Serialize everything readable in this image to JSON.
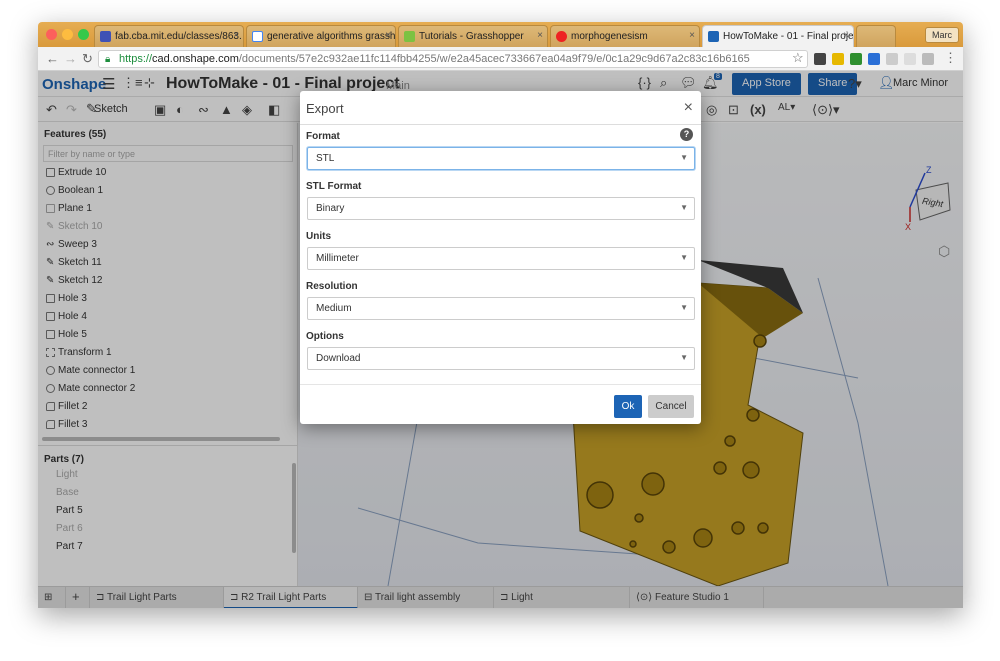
{
  "browser": {
    "tabs": [
      {
        "title": "fab.cba.mit.edu/classes/863.",
        "active": false
      },
      {
        "title": "generative algorithms grassho",
        "active": false
      },
      {
        "title": "Tutorials - Grasshopper",
        "active": false
      },
      {
        "title": "morphogenesism",
        "active": false
      },
      {
        "title": "HowToMake - 01 - Final proje",
        "active": true
      }
    ],
    "profile": "Marc",
    "url": {
      "scheme": "https://",
      "host": "cad.onshape.com",
      "path": "/documents/57e2c932ae11fc114fbb4255/w/e2a45acec733667ea04a9f79/e/0c1a29c9d67a2c83c16b6165"
    }
  },
  "app": {
    "logo": "Onshape",
    "document_title": "HowToMake - 01 - Final project",
    "branch": "Main",
    "app_store_label": "App Store",
    "share_label": "Share",
    "user_name": "Marc Minor",
    "notification_count": "8"
  },
  "toolbar": {
    "sketch_label": "Sketch"
  },
  "features": {
    "header": "Features (55)",
    "filter_placeholder": "Filter by name or type",
    "items": [
      {
        "label": "Extrude 10",
        "icon": "extrude-icon",
        "dim": false
      },
      {
        "label": "Boolean 1",
        "icon": "boolean-icon",
        "dim": false
      },
      {
        "label": "Plane 1",
        "icon": "plane-icon",
        "dim": false
      },
      {
        "label": "Sketch 10",
        "icon": "sketch-icon",
        "dim": true
      },
      {
        "label": "Sweep 3",
        "icon": "sweep-icon",
        "dim": false
      },
      {
        "label": "Sketch 11",
        "icon": "sketch-icon",
        "dim": false
      },
      {
        "label": "Sketch 12",
        "icon": "sketch-icon",
        "dim": false
      },
      {
        "label": "Hole 3",
        "icon": "hole-icon",
        "dim": false
      },
      {
        "label": "Hole 4",
        "icon": "hole-icon",
        "dim": false
      },
      {
        "label": "Hole 5",
        "icon": "hole-icon",
        "dim": false
      },
      {
        "label": "Transform 1",
        "icon": "transform-icon",
        "dim": false
      },
      {
        "label": "Mate connector 1",
        "icon": "mate-connector-icon",
        "dim": false
      },
      {
        "label": "Mate connector 2",
        "icon": "mate-connector-icon",
        "dim": false
      },
      {
        "label": "Fillet 2",
        "icon": "fillet-icon",
        "dim": false
      },
      {
        "label": "Fillet 3",
        "icon": "fillet-icon",
        "dim": false
      }
    ]
  },
  "parts": {
    "header": "Parts (7)",
    "items": [
      {
        "label": "Light",
        "dim": true
      },
      {
        "label": "Base",
        "dim": true
      },
      {
        "label": "Part 5",
        "dim": false
      },
      {
        "label": "Part 6",
        "dim": true
      },
      {
        "label": "Part 7",
        "dim": false
      }
    ]
  },
  "viewcube": {
    "face_label": "Right",
    "axis_z": "Z",
    "axis_x": "X"
  },
  "bottom_tabs": [
    {
      "label": "Trail Light Parts",
      "active": false
    },
    {
      "label": "R2 Trail Light Parts",
      "active": true
    },
    {
      "label": "Trail light assembly",
      "active": false
    },
    {
      "label": "Light",
      "active": false
    },
    {
      "label": "Feature Studio 1",
      "active": false
    }
  ],
  "dialog": {
    "title": "Export",
    "fields": [
      {
        "label": "Format",
        "value": "STL"
      },
      {
        "label": "STL Format",
        "value": "Binary"
      },
      {
        "label": "Units",
        "value": "Millimeter"
      },
      {
        "label": "Resolution",
        "value": "Medium"
      },
      {
        "label": "Options",
        "value": "Download"
      }
    ],
    "ok_label": "Ok",
    "cancel_label": "Cancel"
  },
  "colors": {
    "accent": "#1d64b5",
    "part_body": "#c9a227",
    "chrome_tabbar": "#e0a448"
  }
}
